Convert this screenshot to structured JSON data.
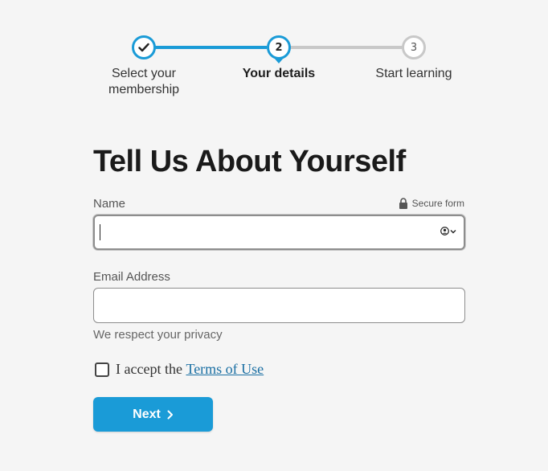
{
  "stepper": {
    "steps": [
      {
        "label": "Select your\nmembership",
        "state": "completed",
        "icon": "check-icon"
      },
      {
        "label": "Your details",
        "number": "2",
        "state": "current"
      },
      {
        "label": "Start learning",
        "number": "3",
        "state": "upcoming"
      }
    ],
    "accent_color": "#1a9bd7",
    "inactive_color": "#c8c8c8"
  },
  "form": {
    "title": "Tell Us About Yourself",
    "secure_label": "Secure form",
    "name": {
      "label": "Name",
      "value": "",
      "placeholder": ""
    },
    "email": {
      "label": "Email Address",
      "value": "",
      "placeholder": ""
    },
    "privacy_hint": "We respect your privacy",
    "terms": {
      "prefix": "I accept the ",
      "link_text": "Terms of Use",
      "checked": false
    },
    "next_label": "Next"
  }
}
